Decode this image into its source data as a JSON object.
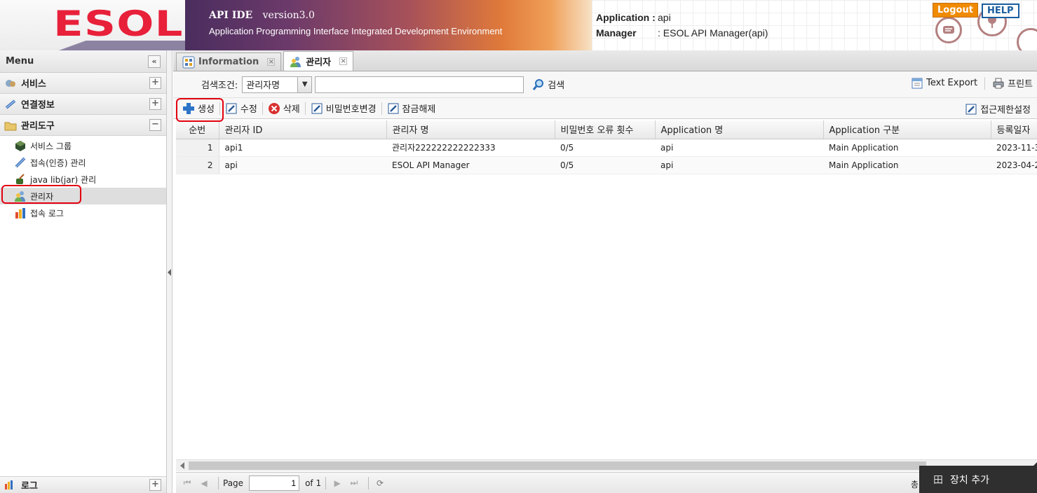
{
  "header": {
    "logo": "ESOL",
    "product": "API IDE",
    "version": "version3.0",
    "subtitle": "Application Programming Interface Integrated Development Environment",
    "application_label": "Application :",
    "application_value": "api",
    "manager_label": "Manager",
    "manager_value": ": ESOL API Manager(api)",
    "logout": "Logout",
    "help": "HELP"
  },
  "menu": {
    "title": "Menu",
    "collapse": "«",
    "sections": [
      {
        "label": "서비스",
        "toggle": "+"
      },
      {
        "label": "연결정보",
        "toggle": "+"
      },
      {
        "label": "관리도구",
        "toggle": "−"
      }
    ],
    "tree": [
      "서비스 그룹",
      "접속(인증) 관리",
      "java lib(jar) 관리",
      "관리자",
      "접속 로그"
    ],
    "bottom": {
      "label": "로그",
      "toggle": "+"
    }
  },
  "tabs": [
    {
      "label": "Information",
      "close": "×"
    },
    {
      "label": "관리자",
      "close": "×"
    }
  ],
  "search": {
    "label": "검색조건:",
    "selected": "관리자명",
    "value": "",
    "button": "검색",
    "text_export": "Text Export",
    "print": "프린트"
  },
  "toolbar": {
    "create": "생성",
    "edit": "수정",
    "delete": "삭제",
    "change_password": "비밀번호변경",
    "unlock": "잠금해제",
    "access_restrict": "접근제한설정"
  },
  "grid": {
    "columns": [
      "순번",
      "관리자 ID",
      "관리자 명",
      "비밀번호 오류 횟수",
      "Application 명",
      "Application 구분",
      "등록일자"
    ],
    "rows": [
      [
        "1",
        "api1",
        "관리자222222222222333",
        "0/5",
        "api",
        "Main Application",
        "2023-11-3"
      ],
      [
        "2",
        "api",
        "ESOL API Manager",
        "0/5",
        "api",
        "Main Application",
        "2023-04-2"
      ]
    ]
  },
  "pager": {
    "page_label": "Page",
    "page_value": "1",
    "of": "of 1",
    "total_partial": "총"
  },
  "popup": {
    "plus": "田",
    "label": "장치 추가"
  },
  "colors": {
    "accent_red": "#e8203a",
    "logout_orange": "#f08a00",
    "help_blue": "#1a5e9e",
    "annotation_red": "#e3000f"
  }
}
